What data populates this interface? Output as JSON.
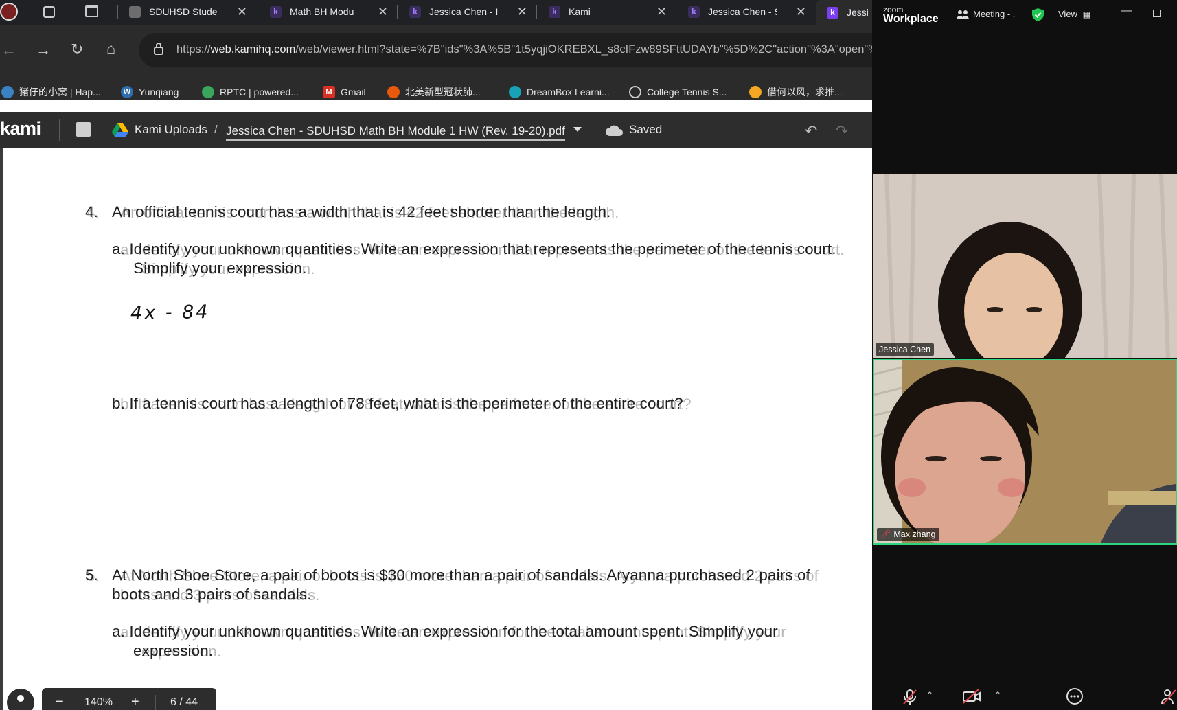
{
  "browser": {
    "tabs": [
      {
        "title": "SDUHSD Stude",
        "favicon": "doc-icon"
      },
      {
        "title": "Math BH Modu",
        "favicon": "kami-icon"
      },
      {
        "title": "Jessica Chen - I",
        "favicon": "kami-icon"
      },
      {
        "title": "Kami",
        "favicon": "kami-icon"
      },
      {
        "title": "Jessica Chen - S",
        "favicon": "kami-icon"
      },
      {
        "title": "Jessi",
        "favicon": "kami-icon"
      }
    ],
    "url_host": "web.kamihq.com",
    "url_prefix": "https://",
    "url_rest": "/web/viewer.html?state=%7B\"ids\"%3A%5B\"1t5yqjiOKREBXL_s8cIFzw89SFttUDAYb\"%5D%2C\"action\"%3A\"open\"%2C",
    "bookmarks": [
      {
        "label": "猪仔的小窝 | Hap...",
        "color": "#3b82c4"
      },
      {
        "label": "Yunqiang",
        "color": "#2f6fb0"
      },
      {
        "label": "RPTC | powered...",
        "color": "#3aa55c"
      },
      {
        "label": "Gmail",
        "color": "#d93025"
      },
      {
        "label": "北美新型冠状肺...",
        "color": "#e8590c"
      },
      {
        "label": "DreamBox Learni...",
        "color": "#17a2b8"
      },
      {
        "label": "College Tennis S...",
        "color": "#9aa0a6"
      },
      {
        "label": "借何以风，求推...",
        "color": "#f5a623"
      }
    ]
  },
  "kami": {
    "logo": "kami",
    "breadcrumb_root": "Kami Uploads",
    "breadcrumb_sep": "/",
    "file_name": "Jessica Chen - SDUHSD Math BH Module 1 HW (Rev. 19-20).pdf",
    "save_status": "Saved",
    "zoom_level": "140%",
    "page_indicator": "6 / 44",
    "zoom_minus": "−",
    "zoom_plus": "+"
  },
  "document": {
    "q4_num": "4.",
    "q4_text": "An official tennis court has a width that is 42 feet shorter than the length.",
    "q4a_line1": "a. Identify your unknown quantities. Write an expression that represents the perimeter of the tennis court.",
    "q4a_line2": "Simplify your expression.",
    "q4a_answer": "4x - 84",
    "q4b_text": "b. If a tennis court has a length of 78 feet, what is the perimeter of the entire court?",
    "q5_num": "5.",
    "q5_line1": "At North Shoe Store, a pair of boots is $30 more than a pair of sandals. Aryanna purchased 2 pairs of",
    "q5_line2": "boots and 3 pairs of sandals.",
    "q5a_line1": "a. Identify your unknown quantities. Write an expression for the total amount spent. Simplify your",
    "q5a_line2": "expression."
  },
  "zoom": {
    "brand_top": "zoom",
    "brand_bottom": "Workplace",
    "meeting_label": "Meeting - .",
    "view_label": "View",
    "participants": [
      {
        "name": "Jessica Chen"
      },
      {
        "name": "Max zhang"
      }
    ],
    "active_speaker_color": "#2fd680"
  }
}
